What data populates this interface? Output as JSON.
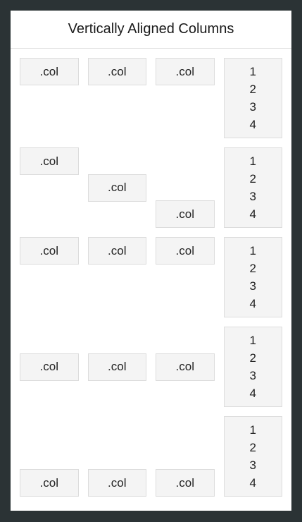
{
  "header": {
    "title": "Vertically Aligned Columns"
  },
  "col_label": ".col",
  "tall_lines": [
    "1",
    "2",
    "3",
    "4"
  ]
}
